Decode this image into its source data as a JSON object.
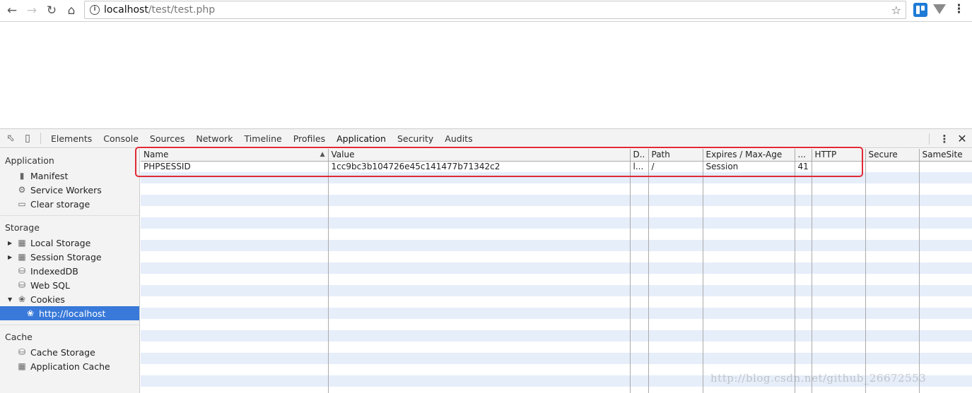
{
  "browser": {
    "url_host": "localhost",
    "url_path": "/test/test.php"
  },
  "devtools": {
    "tabs": [
      "Elements",
      "Console",
      "Sources",
      "Network",
      "Timeline",
      "Profiles",
      "Application",
      "Security",
      "Audits"
    ],
    "active_tab": "Application"
  },
  "sidebar": {
    "application": {
      "title": "Application",
      "items": [
        "Manifest",
        "Service Workers",
        "Clear storage"
      ]
    },
    "storage": {
      "title": "Storage",
      "items": [
        "Local Storage",
        "Session Storage",
        "IndexedDB",
        "Web SQL",
        "Cookies"
      ],
      "cookies_child": "http://localhost"
    },
    "cache": {
      "title": "Cache",
      "items": [
        "Cache Storage",
        "Application Cache"
      ]
    }
  },
  "cookies_table": {
    "headers": [
      "Name",
      "Value",
      "D..",
      "Path",
      "Expires / Max-Age",
      "...",
      "HTTP",
      "Secure",
      "SameSite"
    ],
    "rows": [
      [
        "PHPSESSID",
        "1cc9bc3b104726e45c141477b71342c2",
        "l...",
        "/",
        "Session",
        "41",
        "",
        "",
        ""
      ]
    ]
  },
  "watermark": "http://blog.csdn.net/github_26672553",
  "colors": {
    "selection": "#3879d9",
    "highlight_border": "#e02a35",
    "row_stripe": "#e6eefa"
  }
}
